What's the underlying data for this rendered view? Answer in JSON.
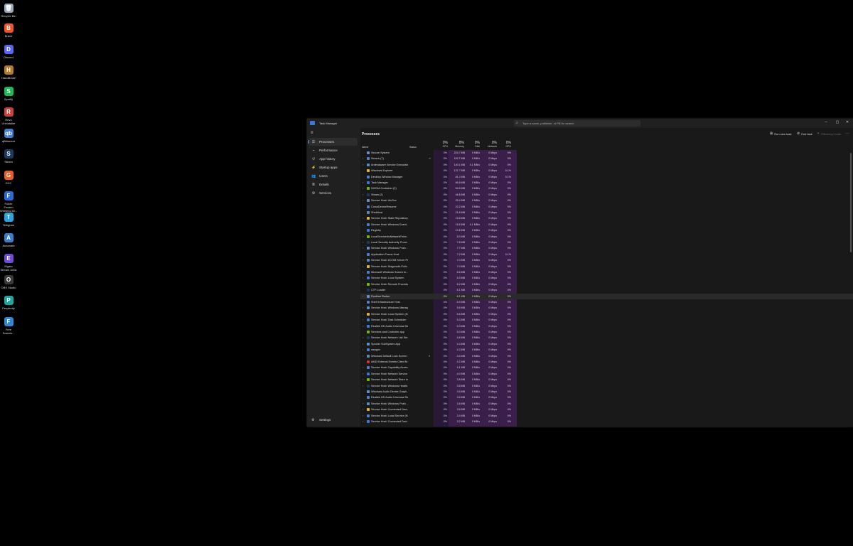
{
  "desktop": {
    "icons": [
      {
        "label": "Recycle Bin",
        "icon": "recycle-bin-icon",
        "color": "#9aa8b8",
        "glyph": "🗑"
      },
      {
        "label": "Brave",
        "icon": "brave-icon",
        "color": "#f0532a",
        "glyph": "B"
      },
      {
        "label": "Discord",
        "icon": "discord-icon",
        "color": "#5865f2",
        "glyph": "D"
      },
      {
        "label": "HandBrake",
        "icon": "handbrake-icon",
        "color": "#b37a2b",
        "glyph": "H"
      },
      {
        "label": "Spotify",
        "icon": "spotify-icon",
        "color": "#1db954",
        "glyph": "S"
      },
      {
        "label": "Revo\nUninstaller",
        "icon": "revo-uninstaller-icon",
        "color": "#c8413b",
        "glyph": "R"
      },
      {
        "label": "qBittorrent",
        "icon": "qbittorrent-icon",
        "color": "#3b7fd0",
        "glyph": "qb"
      },
      {
        "label": "Steam",
        "icon": "steam-icon",
        "color": "#1b3a5c",
        "glyph": "S"
      },
      {
        "label": "GCC",
        "icon": "gcc-icon",
        "color": "#e85d25",
        "glyph": "G"
      },
      {
        "label": "Fulcer Foxiem\nWireless Mi...",
        "icon": "mouse-software-icon",
        "color": "#2a6ad8",
        "glyph": "F"
      },
      {
        "label": "Telegram",
        "icon": "telegram-icon",
        "color": "#2aa3df",
        "glyph": "T"
      },
      {
        "label": "Automate",
        "icon": "automate-icon",
        "color": "#3a7fc8",
        "glyph": "A"
      },
      {
        "label": "Elgato\nStream Deck",
        "icon": "stream-deck-icon",
        "color": "#6f4ad8",
        "glyph": "E"
      },
      {
        "label": "OBS Studio",
        "icon": "obs-studio-icon",
        "color": "#3a3a3a",
        "glyph": "O"
      },
      {
        "label": "Perplexity",
        "icon": "perplexity-icon",
        "color": "#1fa6a0",
        "glyph": "P"
      },
      {
        "label": "Free\nDownlo...",
        "icon": "free-download-manager-icon",
        "color": "#2f86d6",
        "glyph": "F"
      }
    ]
  },
  "window": {
    "title": "Task Manager",
    "search_placeholder": "Type a name, publisher, or PID to search",
    "minimize": "─",
    "maximize": "▢",
    "close": "✕"
  },
  "sidebar": {
    "items": [
      {
        "label": "Processes",
        "icon": "processes-icon",
        "glyph": "☰",
        "active": true
      },
      {
        "label": "Performance",
        "icon": "performance-icon",
        "glyph": "⌁"
      },
      {
        "label": "App history",
        "icon": "app-history-icon",
        "glyph": "↺"
      },
      {
        "label": "Startup apps",
        "icon": "startup-apps-icon",
        "glyph": "⚡"
      },
      {
        "label": "Users",
        "icon": "users-icon",
        "glyph": "👥"
      },
      {
        "label": "Details",
        "icon": "details-icon",
        "glyph": "≣"
      },
      {
        "label": "Services",
        "icon": "services-icon",
        "glyph": "⚙"
      }
    ],
    "settings_label": "Settings"
  },
  "toolbar": {
    "page_title": "Processes",
    "run_new_task": "Run new task",
    "end_task": "End task",
    "efficiency_mode": "Efficiency mode",
    "more": "⋯"
  },
  "columns": {
    "name": "Name",
    "status": "Status",
    "cpu": {
      "pct": "0%",
      "label": "CPU"
    },
    "memory": {
      "pct": "8%",
      "label": "Memory"
    },
    "disk": {
      "pct": "0%",
      "label": "Disk"
    },
    "network": {
      "pct": "0%",
      "label": "Network"
    },
    "gpu": {
      "pct": "0%",
      "label": "GPU"
    }
  },
  "colors": {
    "memory_column": "#3a1f4a",
    "cpu_column": "#2a1838",
    "accent": "#7fb2f0"
  },
  "processes": [
    {
      "name": "Secure System",
      "expand": false,
      "cpu": "0%",
      "mem": "224.7 MB",
      "disk": "0 MB/s",
      "net": "0 Mbps",
      "gpu": "0%"
    },
    {
      "name": "Search (7)",
      "expand": true,
      "status": "leaf",
      "cpu": "0%",
      "mem": "162.7 MB",
      "disk": "0 MB/s",
      "net": "0 Mbps",
      "gpu": "0%"
    },
    {
      "name": "Antimalware Service Executable",
      "expand": true,
      "cpu": "0%",
      "mem": "140.1 MB",
      "disk": "0.1 MB/s",
      "net": "0 Mbps",
      "gpu": "0%"
    },
    {
      "name": "Windows Explorer",
      "expand": false,
      "cpu": "0%",
      "mem": "121.7 MB",
      "disk": "0 MB/s",
      "net": "0 Mbps",
      "gpu": "0.1%"
    },
    {
      "name": "Desktop Window Manager",
      "expand": false,
      "cpu": "0%",
      "mem": "81.2 MB",
      "disk": "0 MB/s",
      "net": "0 Mbps",
      "gpu": "0.1%"
    },
    {
      "name": "Task Manager",
      "expand": true,
      "cpu": "0%",
      "mem": "66.8 MB",
      "disk": "0 MB/s",
      "net": "0 Mbps",
      "gpu": "0%"
    },
    {
      "name": "NVIDIA Container (2)",
      "expand": true,
      "cpu": "0%",
      "mem": "54.6 MB",
      "disk": "0 MB/s",
      "net": "0 Mbps",
      "gpu": "0%"
    },
    {
      "name": "Steam (2)",
      "expand": true,
      "cpu": "0%",
      "mem": "46.8 MB",
      "disk": "0 MB/s",
      "net": "0 Mbps",
      "gpu": "0%"
    },
    {
      "name": "Service Host: UtcSvc",
      "expand": true,
      "cpu": "0%",
      "mem": "25.4 MB",
      "disk": "0 MB/s",
      "net": "0 Mbps",
      "gpu": "0%"
    },
    {
      "name": "CrossDeviceResume",
      "expand": false,
      "cpu": "0%",
      "mem": "22.2 MB",
      "disk": "0 MB/s",
      "net": "0 Mbps",
      "gpu": "0%"
    },
    {
      "name": "ShellHost",
      "expand": false,
      "cpu": "0%",
      "mem": "21.6 MB",
      "disk": "0 MB/s",
      "net": "0 Mbps",
      "gpu": "0%"
    },
    {
      "name": "Service Host: State Repository ...",
      "expand": true,
      "cpu": "0%",
      "mem": "15.8 MB",
      "disk": "0 MB/s",
      "net": "0 Mbps",
      "gpu": "0%"
    },
    {
      "name": "Service Host: Windows Event ...",
      "expand": true,
      "cpu": "0%",
      "mem": "15.5 MB",
      "disk": "0.1 MB/s",
      "net": "0 Mbps",
      "gpu": "0%"
    },
    {
      "name": "Registry",
      "expand": false,
      "cpu": "0%",
      "mem": "10.8 MB",
      "disk": "0 MB/s",
      "net": "0 Mbps",
      "gpu": "0%"
    },
    {
      "name": "LocalServiceNoNetworkFirew...",
      "expand": true,
      "cpu": "0%",
      "mem": "8.0 MB",
      "disk": "0 MB/s",
      "net": "0 Mbps",
      "gpu": "0%"
    },
    {
      "name": "Local Security Authority Proce...",
      "expand": true,
      "cpu": "0%",
      "mem": "7.8 MB",
      "disk": "0 MB/s",
      "net": "0 Mbps",
      "gpu": "0%"
    },
    {
      "name": "Service Host: Windows Push ...",
      "expand": true,
      "cpu": "0%",
      "mem": "7.7 MB",
      "disk": "0 MB/s",
      "net": "0 Mbps",
      "gpu": "0%"
    },
    {
      "name": "Application Frame Host",
      "expand": false,
      "cpu": "0%",
      "mem": "7.2 MB",
      "disk": "0 MB/s",
      "net": "0 Mbps",
      "gpu": "0.1%"
    },
    {
      "name": "Service Host: DCOM Server Pr...",
      "expand": true,
      "cpu": "0%",
      "mem": "7.0 MB",
      "disk": "0 MB/s",
      "net": "0 Mbps",
      "gpu": "0%"
    },
    {
      "name": "Service Host: Diagnostic Polic...",
      "expand": true,
      "cpu": "0%",
      "mem": "7.0 MB",
      "disk": "0 MB/s",
      "net": "0 Mbps",
      "gpu": "0%"
    },
    {
      "name": "Microsoft Windows Search In...",
      "expand": true,
      "cpu": "0%",
      "mem": "6.6 MB",
      "disk": "0 MB/s",
      "net": "0 Mbps",
      "gpu": "0%"
    },
    {
      "name": "Service Host: Local System",
      "expand": true,
      "cpu": "0%",
      "mem": "6.3 MB",
      "disk": "0 MB/s",
      "net": "0 Mbps",
      "gpu": "0%"
    },
    {
      "name": "Service Host: Remote Procedu...",
      "expand": true,
      "cpu": "0%",
      "mem": "6.2 MB",
      "disk": "0 MB/s",
      "net": "0 Mbps",
      "gpu": "0%"
    },
    {
      "name": "CTF Loader",
      "expand": false,
      "cpu": "0%",
      "mem": "6.1 MB",
      "disk": "0 MB/s",
      "net": "0 Mbps",
      "gpu": "0%"
    },
    {
      "name": "Runtime Broker",
      "expand": true,
      "cpu": "0%",
      "mem": "6.1 MB",
      "disk": "0 MB/s",
      "net": "0 Mbps",
      "gpu": "0%",
      "highlight": true
    },
    {
      "name": "Shell Infrastructure Host",
      "expand": false,
      "cpu": "0%",
      "mem": "5.9 MB",
      "disk": "0 MB/s",
      "net": "0 Mbps",
      "gpu": "0%"
    },
    {
      "name": "Service Host: Windows Manag...",
      "expand": true,
      "cpu": "0%",
      "mem": "5.6 MB",
      "disk": "0 MB/s",
      "net": "0 Mbps",
      "gpu": "0%"
    },
    {
      "name": "Service Host: Local System (N...",
      "expand": true,
      "cpu": "0%",
      "mem": "5.6 MB",
      "disk": "0 MB/s",
      "net": "0 Mbps",
      "gpu": "0%"
    },
    {
      "name": "Service Host: Task Scheduler",
      "expand": true,
      "cpu": "0%",
      "mem": "5.3 MB",
      "disk": "0 MB/s",
      "net": "0 Mbps",
      "gpu": "0%"
    },
    {
      "name": "Realtek HD Audio Universal Se...",
      "expand": true,
      "cpu": "0%",
      "mem": "5.3 MB",
      "disk": "0 MB/s",
      "net": "0 Mbps",
      "gpu": "0%"
    },
    {
      "name": "Services and Controller app",
      "expand": false,
      "cpu": "0%",
      "mem": "5.0 MB",
      "disk": "0 MB/s",
      "net": "0 Mbps",
      "gpu": "0%"
    },
    {
      "name": "Service Host: Network List Ser...",
      "expand": true,
      "cpu": "0%",
      "mem": "4.6 MB",
      "disk": "0 MB/s",
      "net": "0 Mbps",
      "gpu": "0%"
    },
    {
      "name": "Spooler SubSystem App",
      "expand": true,
      "cpu": "0%",
      "mem": "4.3 MB",
      "disk": "0 MB/s",
      "net": "0 Mbps",
      "gpu": "0%"
    },
    {
      "name": "wsappx",
      "expand": true,
      "cpu": "0%",
      "mem": "4.3 MB",
      "disk": "0 MB/s",
      "net": "0 Mbps",
      "gpu": "0%"
    },
    {
      "name": "Windows Default Lock Screen ...",
      "expand": true,
      "status": "pause",
      "cpu": "0%",
      "mem": "4.4 MB",
      "disk": "0 MB/s",
      "net": "0 Mbps",
      "gpu": "0%"
    },
    {
      "name": "AMD External Events Client M...",
      "expand": false,
      "amd": true,
      "cpu": "0%",
      "mem": "4.2 MB",
      "disk": "0 MB/s",
      "net": "0 Mbps",
      "gpu": "0%"
    },
    {
      "name": "Service Host: Capability Acces...",
      "expand": true,
      "cpu": "0%",
      "mem": "4.1 MB",
      "disk": "0 MB/s",
      "net": "0 Mbps",
      "gpu": "0%"
    },
    {
      "name": "Service Host: Network Service",
      "expand": true,
      "cpu": "0%",
      "mem": "4.0 MB",
      "disk": "0 MB/s",
      "net": "0 Mbps",
      "gpu": "0%"
    },
    {
      "name": "Service Host: Network Store In...",
      "expand": true,
      "cpu": "0%",
      "mem": "3.8 MB",
      "disk": "0 MB/s",
      "net": "0 Mbps",
      "gpu": "0%"
    },
    {
      "name": "Service Host: Windows Health...",
      "expand": true,
      "cpu": "0%",
      "mem": "3.8 MB",
      "disk": "0 MB/s",
      "net": "0 Mbps",
      "gpu": "0%"
    },
    {
      "name": "Windows Audio Device Graph ...",
      "expand": false,
      "cpu": "0%",
      "mem": "3.6 MB",
      "disk": "0 MB/s",
      "net": "0 Mbps",
      "gpu": "0%"
    },
    {
      "name": "Realtek HD Audio Universal Se...",
      "expand": false,
      "cpu": "0%",
      "mem": "3.6 MB",
      "disk": "0 MB/s",
      "net": "0 Mbps",
      "gpu": "0%"
    },
    {
      "name": "Service Host: Windows Push ...",
      "expand": true,
      "cpu": "0%",
      "mem": "3.6 MB",
      "disk": "0 MB/s",
      "net": "0 Mbps",
      "gpu": "0%"
    },
    {
      "name": "Service Host: Connected Devi...",
      "expand": true,
      "cpu": "0%",
      "mem": "3.6 MB",
      "disk": "0 MB/s",
      "net": "0 Mbps",
      "gpu": "0%"
    },
    {
      "name": "Service Host: Local Service (N...",
      "expand": true,
      "cpu": "0%",
      "mem": "3.4 MB",
      "disk": "0 MB/s",
      "net": "0 Mbps",
      "gpu": "0%"
    },
    {
      "name": "Service Host: Connected Devi...",
      "expand": true,
      "cpu": "0%",
      "mem": "3.2 MB",
      "disk": "0 MB/s",
      "net": "0 Mbps",
      "gpu": "0%"
    }
  ]
}
